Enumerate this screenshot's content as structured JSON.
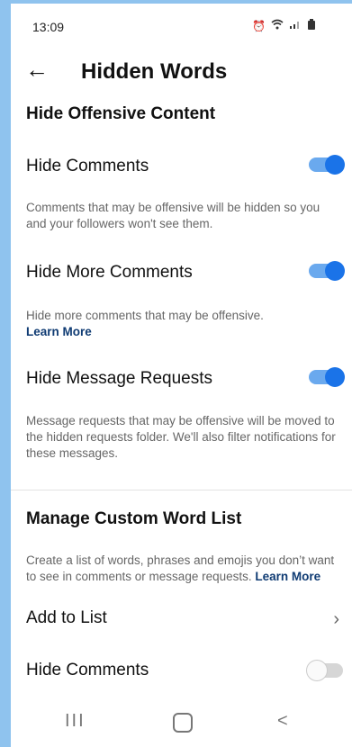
{
  "status": {
    "time": "13:09",
    "icons": [
      "alarm-icon",
      "wifi-icon",
      "signal-icon",
      "battery-icon"
    ]
  },
  "header": {
    "title": "Hidden Words"
  },
  "offensive": {
    "section_title": "Hide Offensive Content",
    "hide_comments": {
      "label": "Hide Comments",
      "enabled": true,
      "description": "Comments that may be offensive will be hidden so you and your followers won't see them."
    },
    "hide_more_comments": {
      "label": "Hide More Comments",
      "enabled": true,
      "description": "Hide more comments that may be offensive.",
      "link": "Learn More"
    },
    "hide_message_requests": {
      "label": "Hide Message Requests",
      "enabled": true,
      "description": "Message requests that may be offensive will be moved to the hidden requests folder. We'll also filter notifications for these messages."
    }
  },
  "custom": {
    "section_title": "Manage Custom Word List",
    "description": "Create a list of words, phrases and emojis you don’t want to see in comments or message requests.",
    "link": "Learn More",
    "add_to_list": "Add to List",
    "hide_comments": {
      "label": "Hide Comments",
      "enabled": false
    }
  },
  "nav": {
    "recent": "III",
    "back": "<"
  },
  "colors": {
    "toggle_on": "#1a73e8",
    "link": "#0f3b73"
  }
}
